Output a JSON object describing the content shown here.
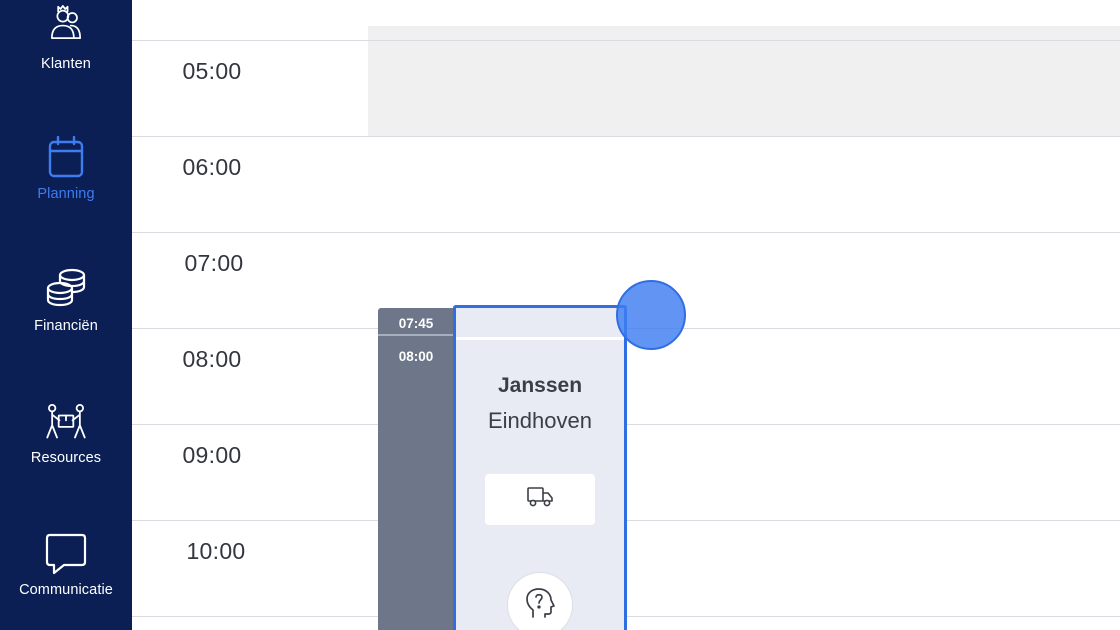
{
  "sidebar": {
    "items": [
      {
        "label": "Klanten",
        "icon": "customers-icon",
        "active": false
      },
      {
        "label": "Planning",
        "icon": "calendar-icon",
        "active": true
      },
      {
        "label": "Financiën",
        "icon": "coins-icon",
        "active": false
      },
      {
        "label": "Resources",
        "icon": "movers-icon",
        "active": false
      },
      {
        "label": "Communicatie",
        "icon": "chat-icon",
        "active": false
      }
    ]
  },
  "planner": {
    "hours": [
      "05:00",
      "06:00",
      "07:00",
      "08:00",
      "09:00",
      "10:00"
    ]
  },
  "event": {
    "start_time": "07:45",
    "end_time": "08:00",
    "customer": "Janssen",
    "city": "Eindhoven",
    "vehicle_icon": "truck-icon",
    "status_icon": "question-head-icon"
  },
  "colors": {
    "sidebar_bg": "#0b1f55",
    "accent": "#3e7cf0",
    "event_border": "#2f6fe3",
    "event_bg": "#e8ebf4",
    "time_bar": "#6d7789"
  }
}
